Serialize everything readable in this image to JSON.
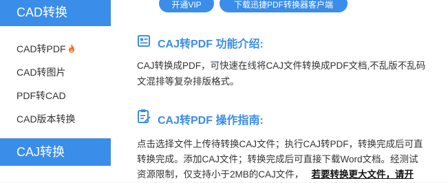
{
  "sidebar": {
    "header1": "CAD转换",
    "items": [
      {
        "label": "CAD转PDF",
        "icon": "flame-icon"
      },
      {
        "label": "CAD转图片"
      },
      {
        "label": "PDF转CAD"
      },
      {
        "label": "CAD版本转换"
      }
    ],
    "header2": "CAJ转换"
  },
  "top_buttons": {
    "vip": "开通VIP",
    "download": "下载迅捷PDF转换器客户端"
  },
  "intro": {
    "title": "CAJ转PDF 功能介绍:",
    "line1": "CAJ转换成PDF，可快速在线将CAJ文件转换成PDF文档,不乱版不乱码",
    "line2": "文混排等复杂排版格式。"
  },
  "guide": {
    "title": "CAJ转PDF 操作指南:",
    "line1": "点击选择文件上传待转换CAJ文件；执行CAJ转PDF，转换完成后可直",
    "line2": "转换完成。添加CAJ文件；转换完成后可直接下载Word文档。经测试",
    "line3": "资源限制，仅支持小于2MB的CAJ文件，",
    "line3_bold": "若要转换更大文件，请开"
  },
  "colors": {
    "accent": "#3a8de8",
    "flame": "#f0742a"
  }
}
